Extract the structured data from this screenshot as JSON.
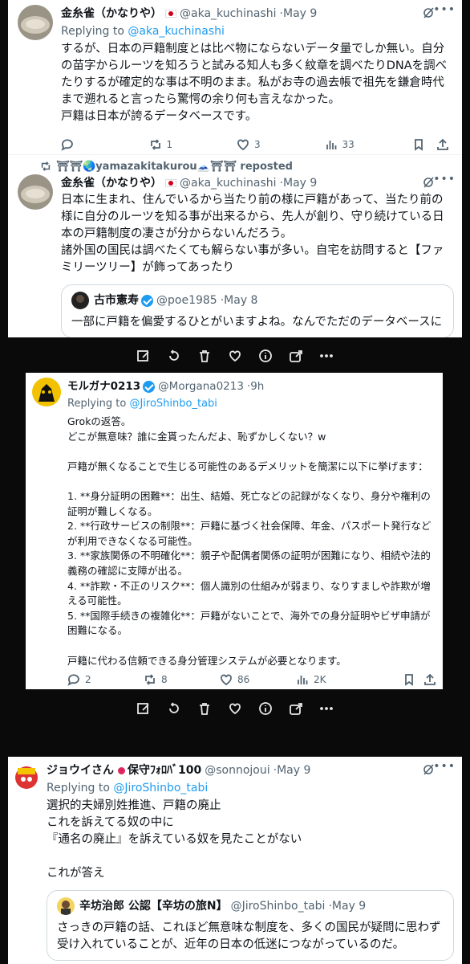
{
  "post1": {
    "author": "金糸雀（かなりや）",
    "handle": "@aka_kuchinashi",
    "time": "May 9",
    "replying_prefix": "Replying to ",
    "replying_to": "@aka_kuchinashi",
    "text": "するが、日本の戸籍制度とは比べ物にならないデータ量でしか無い。自分の苗字からルーツを知ろうと試みる知人も多く紋章を調べたりDNAを調べたりするが確定的な事は不明のまま。私がお寺の過去帳で祖先を鎌倉時代まで遡れると言ったら驚愕の余り何も言えなかった。\n戸籍は日本が誇るデータベースです。",
    "reposts": "1",
    "likes": "3",
    "views": "33"
  },
  "post2": {
    "reposter": "⛩⛩🌏yamazakitakurou🗻⛩⛩ reposted",
    "author": "金糸雀（かなりや）",
    "handle": "@aka_kuchinashi",
    "time": "May 9",
    "text": "日本に生まれ、住んでいるから当たり前の様に戸籍があって、当たり前の様に自分のルーツを知る事が出来るから、先人が創り、守り続けている日本の戸籍制度の凄さが分からないんだろう。\n諸外国の国民は調べたくても解らない事が多い。自宅を訪問すると【ファミリーツリー】が飾ってあったり",
    "quote": {
      "author": "古市憲寿",
      "handle": "@poe1985",
      "time": "May 8",
      "text": "一部に戸籍を偏愛するひとがいますよね。なんでただのデータベースに"
    }
  },
  "post3": {
    "author": "モルガナ0213",
    "handle": "@Morgana0213",
    "time": "9h",
    "replying_prefix": "Replying to ",
    "replying_to": "@JiroShinbo_tabi",
    "text": "Grokの返答。\nどこが無意味？誰に金貰ったんだよ、恥ずかしくない？w\n\n戸籍が無くなることで生じる可能性のあるデメリットを簡潔に以下に挙げます：\n\n1. **身分証明の困難**：出生、結婚、死亡などの記録がなくなり、身分や権利の証明が難しくなる。\n2. **行政サービスの制限**：戸籍に基づく社会保障、年金、パスポート発行などが利用できなくなる可能性。\n3. **家族関係の不明確化**：親子や配偶者関係の証明が困難になり、相続や法的義務の確認に支障が出る。\n4. **詐欺・不正のリスク**：個人識別の仕組みが弱まり、なりすましや詐欺が増える可能性。\n5. **国際手続きの複雑化**：戸籍がないことで、海外での身分証明やビザ申請が困難になる。\n\n戸籍に代わる信頼できる身分管理システムが必要となります。",
    "replies": "2",
    "reposts": "8",
    "likes": "86",
    "views": "2K"
  },
  "post4": {
    "author": "ジョウイさん",
    "author_suffix": "保守ﾌｫﾛﾊﾞ100",
    "handle": "@sonnojoui",
    "time": "May 9",
    "replying_prefix": "Replying to ",
    "replying_to": "@JiroShinbo_tabi",
    "text": "選択的夫婦別姓推進、戸籍の廃止\nこれを訴えてる奴の中に\n『通名の廃止』を訴えている奴を見たことがない\n\nこれが答え",
    "quote": {
      "author": "辛坊治郎 公認【辛坊の旅N】",
      "handle": "@JiroShinbo_tabi",
      "time": "May 9",
      "text": "さっきの戸籍の話、これほど無意味な制度を、多くの国民が疑問に思わず受け入れていることが、近年の日本の低迷につながっているのだ。"
    }
  },
  "separator": " · "
}
